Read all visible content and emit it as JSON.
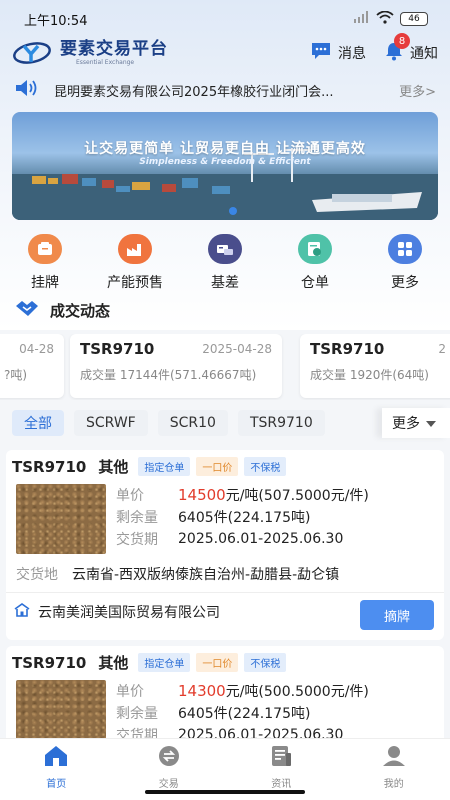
{
  "status_bar": {
    "time": "上午10:54",
    "battery": "46"
  },
  "header": {
    "app_name": "要素交易平台",
    "app_sub": "Essential Exchange",
    "messages_label": "消息",
    "notifications_label": "通知",
    "notifications_badge": "8"
  },
  "notice": {
    "text": "昆明要素交易有限公司2025年橡胶行业闭门会...",
    "more": "更多>"
  },
  "banner": {
    "title": "让交易更简单  让贸易更自由  让流通更高效",
    "subtitle": "Simpleness & Freedom & Efficient"
  },
  "quick_nav": [
    {
      "label": "挂牌",
      "icon": "listing-icon",
      "color": "#f08a4b"
    },
    {
      "label": "产能预售",
      "icon": "factory-icon",
      "color": "#f0743e"
    },
    {
      "label": "基差",
      "icon": "basis-icon",
      "color": "#4a4e8c"
    },
    {
      "label": "仓单",
      "icon": "warehouse-receipt-icon",
      "color": "#4fc2a8"
    },
    {
      "label": "更多",
      "icon": "grid-icon",
      "color": "#4d7fe0"
    }
  ],
  "deals": {
    "title": "成交动态",
    "cards": [
      {
        "symbol": "",
        "date": "04-28",
        "volume": "?吨)"
      },
      {
        "symbol": "TSR9710",
        "date": "2025-04-28",
        "volume": "成交量 17144件(571.46667吨)"
      },
      {
        "symbol": "TSR9710",
        "date": "2",
        "volume": "成交量 1920件(64吨)"
      }
    ]
  },
  "filters": {
    "chips": [
      "全部",
      "SCRWF",
      "SCR10",
      "TSR9710"
    ],
    "more": "更多"
  },
  "listings": [
    {
      "symbol": "TSR9710",
      "category": "其他",
      "tags": [
        "指定仓单",
        "一口价",
        "不保税"
      ],
      "price_label": "单价",
      "price": "14500",
      "price_unit": "元/吨(507.5000元/件)",
      "remaining_label": "剩余量",
      "remaining": "6405件(224.175吨)",
      "delivery_period_label": "交货期",
      "delivery_period": "2025.06.01-2025.06.30",
      "delivery_place_label": "交货地",
      "delivery_place": "云南省-西双版纳傣族自治州-勐腊县-勐仑镇",
      "seller": "云南美润美国际贸易有限公司",
      "action": "摘牌"
    },
    {
      "symbol": "TSR9710",
      "category": "其他",
      "tags": [
        "指定仓单",
        "一口价",
        "不保税"
      ],
      "price_label": "单价",
      "price": "14300",
      "price_unit": "元/吨(500.5000元/件)",
      "remaining_label": "剩余量",
      "remaining": "6405件(224.175吨)",
      "delivery_period_label": "交货期",
      "delivery_period": "2025.06.01-2025.06.30"
    }
  ],
  "tabbar": [
    {
      "label": "首页",
      "icon": "home-icon",
      "active": true
    },
    {
      "label": "交易",
      "icon": "exchange-icon",
      "active": false
    },
    {
      "label": "资讯",
      "icon": "news-icon",
      "active": false
    },
    {
      "label": "我的",
      "icon": "profile-icon",
      "active": false
    }
  ]
}
